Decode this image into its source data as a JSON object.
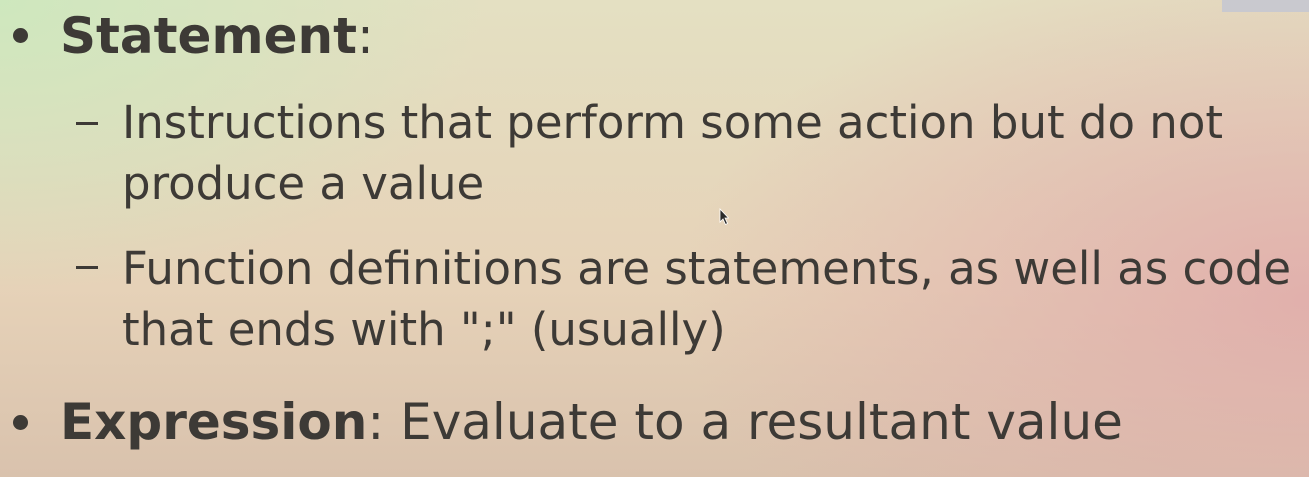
{
  "slide": {
    "statement": {
      "term": "Statement",
      "separator": ":",
      "points": [
        {
          "line1": "Instructions that perform some action but do not",
          "line2": "produce a value"
        },
        {
          "line1": "Function definitions are statements, as well as code",
          "line2": "that ends with \";\" (usually)"
        }
      ]
    },
    "expression": {
      "term": "Expression",
      "definition": ": Evaluate to a resultant value"
    }
  }
}
